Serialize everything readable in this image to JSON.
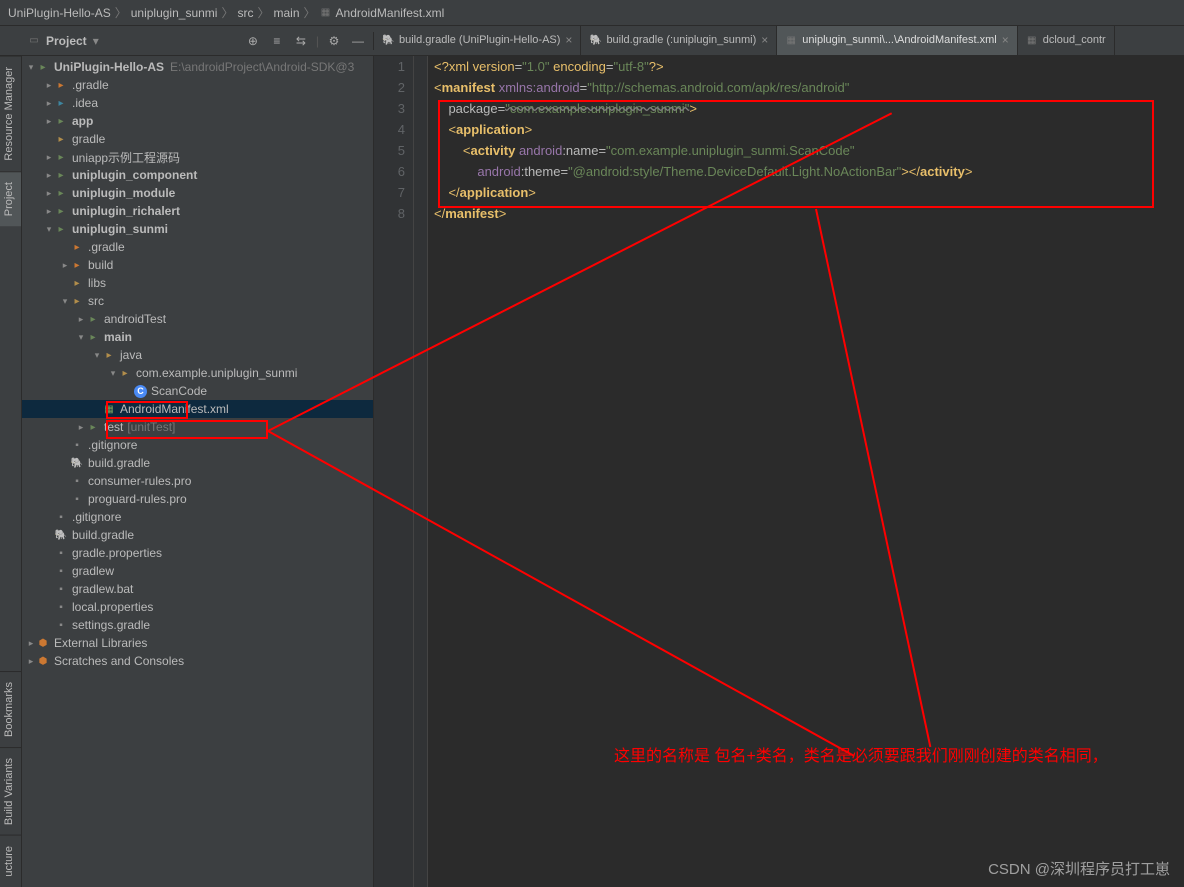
{
  "breadcrumb": [
    "UniPlugin-Hello-AS",
    "uniplugin_sunmi",
    "src",
    "main",
    "AndroidManifest.xml"
  ],
  "project_panel": {
    "title": "Project"
  },
  "toolbar_icons": [
    "target-icon",
    "collapse-icon",
    "expand-icon",
    "divider",
    "gear-icon",
    "hide-icon"
  ],
  "tree": {
    "root": {
      "name": "UniPlugin-Hello-AS",
      "path": "E:\\androidProject\\Android-SDK@3"
    },
    "items": [
      {
        "d": 1,
        "arrow": ">",
        "icon": "folder-orange",
        "label": ".gradle"
      },
      {
        "d": 1,
        "arrow": ">",
        "icon": "folder-blue",
        "label": ".idea"
      },
      {
        "d": 1,
        "arrow": ">",
        "icon": "folder-green",
        "label": "app",
        "bold": true
      },
      {
        "d": 1,
        "arrow": "",
        "icon": "folder",
        "label": "gradle"
      },
      {
        "d": 1,
        "arrow": ">",
        "icon": "folder-green",
        "label": "uniapp示例工程源码"
      },
      {
        "d": 1,
        "arrow": ">",
        "icon": "folder-green",
        "label": "uniplugin_component",
        "bold": true
      },
      {
        "d": 1,
        "arrow": ">",
        "icon": "folder-green",
        "label": "uniplugin_module",
        "bold": true
      },
      {
        "d": 1,
        "arrow": ">",
        "icon": "folder-green",
        "label": "uniplugin_richalert",
        "bold": true
      },
      {
        "d": 1,
        "arrow": "v",
        "icon": "folder-green",
        "label": "uniplugin_sunmi",
        "bold": true
      },
      {
        "d": 2,
        "arrow": "",
        "icon": "folder-orange",
        "label": ".gradle"
      },
      {
        "d": 2,
        "arrow": ">",
        "icon": "folder-orange",
        "label": "build"
      },
      {
        "d": 2,
        "arrow": "",
        "icon": "folder",
        "label": "libs"
      },
      {
        "d": 2,
        "arrow": "v",
        "icon": "folder",
        "label": "src"
      },
      {
        "d": 3,
        "arrow": ">",
        "icon": "folder-green",
        "label": "androidTest"
      },
      {
        "d": 3,
        "arrow": "v",
        "icon": "folder-green",
        "label": "main",
        "bold": true
      },
      {
        "d": 4,
        "arrow": "v",
        "icon": "folder",
        "label": "java"
      },
      {
        "d": 5,
        "arrow": "v",
        "icon": "folder",
        "label": "com.example.uniplugin_sunmi"
      },
      {
        "d": 6,
        "arrow": "",
        "icon": "class",
        "label": "ScanCode"
      },
      {
        "d": 4,
        "arrow": "",
        "icon": "xml",
        "label": "AndroidManifest.xml",
        "selected": true
      },
      {
        "d": 3,
        "arrow": ">",
        "icon": "folder-green",
        "label": "test",
        "suffix": "[unitTest]"
      },
      {
        "d": 2,
        "arrow": "",
        "icon": "file",
        "label": ".gitignore"
      },
      {
        "d": 2,
        "arrow": "",
        "icon": "gradle",
        "label": "build.gradle"
      },
      {
        "d": 2,
        "arrow": "",
        "icon": "file",
        "label": "consumer-rules.pro"
      },
      {
        "d": 2,
        "arrow": "",
        "icon": "file",
        "label": "proguard-rules.pro"
      },
      {
        "d": 1,
        "arrow": "",
        "icon": "file",
        "label": ".gitignore"
      },
      {
        "d": 1,
        "arrow": "",
        "icon": "gradle",
        "label": "build.gradle"
      },
      {
        "d": 1,
        "arrow": "",
        "icon": "file",
        "label": "gradle.properties"
      },
      {
        "d": 1,
        "arrow": "",
        "icon": "file",
        "label": "gradlew"
      },
      {
        "d": 1,
        "arrow": "",
        "icon": "file",
        "label": "gradlew.bat"
      },
      {
        "d": 1,
        "arrow": "",
        "icon": "file",
        "label": "local.properties"
      },
      {
        "d": 1,
        "arrow": "",
        "icon": "file",
        "label": "settings.gradle"
      }
    ],
    "extras": [
      "External Libraries",
      "Scratches and Consoles"
    ]
  },
  "tabs": [
    {
      "label": "build.gradle (UniPlugin-Hello-AS)",
      "icon": "gradle"
    },
    {
      "label": "build.gradle (:uniplugin_sunmi)",
      "icon": "gradle"
    },
    {
      "label": "uniplugin_sunmi\\...\\AndroidManifest.xml",
      "icon": "xml",
      "active": true
    },
    {
      "label": "dcloud_contr",
      "icon": "xml"
    }
  ],
  "code": {
    "lines": 8,
    "l1": "<?xml version=\"1.0\" encoding=\"utf-8\"?>",
    "manifest_attr": "xmlns:android",
    "manifest_url": "\"http://schemas.android.com/apk/res/android\"",
    "package_attr": "package",
    "package_val": "\"com.example.uniplugin_sunmi\"",
    "activity_name_attr": "android:name",
    "activity_name_val": "\"com.example.uniplugin_sunmi.ScanCode\"",
    "activity_theme_attr": "android:theme",
    "activity_theme_val": "\"@android:style/Theme.DeviceDefault.Light.NoActionBar\""
  },
  "annotation": "这里的名称是 包名+类名，类名是必须要跟我们刚刚创建的类名相同，",
  "left_tabs": [
    "Resource Manager",
    "Project",
    "Bookmarks",
    "Build Variants",
    "ucture"
  ],
  "watermark": "CSDN @深圳程序员打工崽"
}
